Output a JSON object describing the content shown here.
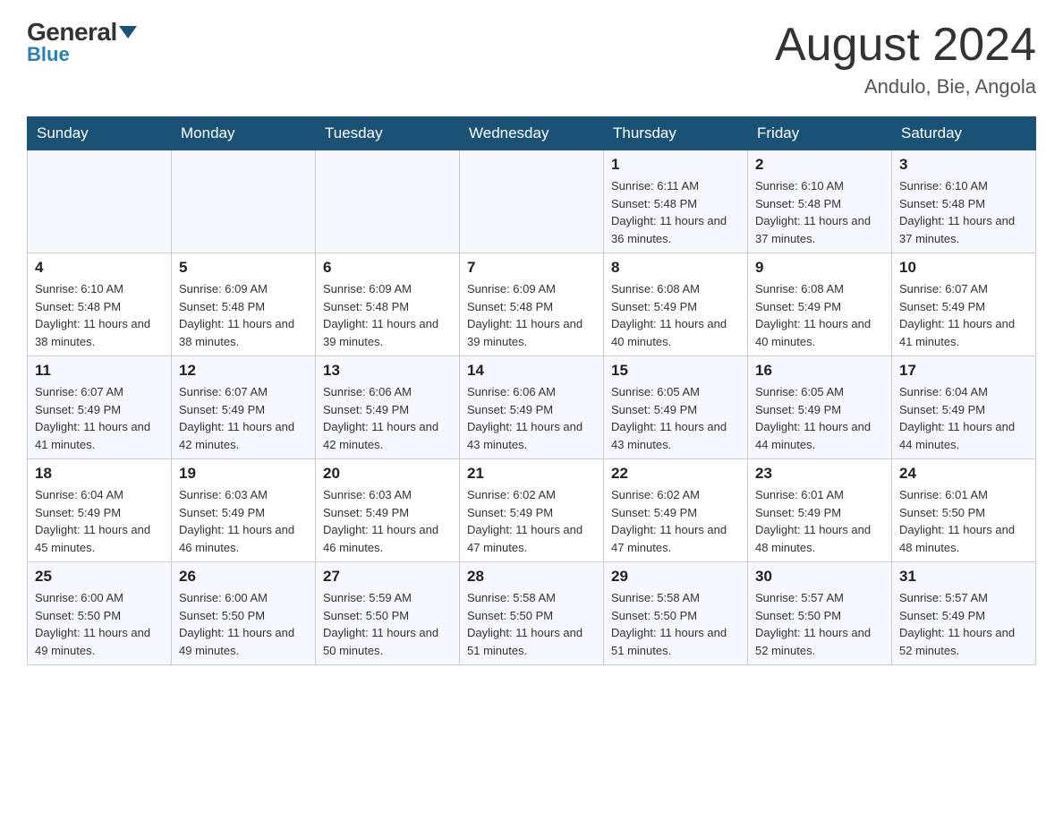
{
  "header": {
    "logo_general": "General",
    "logo_blue": "Blue",
    "month_year": "August 2024",
    "location": "Andulo, Bie, Angola"
  },
  "days_of_week": [
    "Sunday",
    "Monday",
    "Tuesday",
    "Wednesday",
    "Thursday",
    "Friday",
    "Saturday"
  ],
  "weeks": [
    [
      {
        "day": "",
        "info": ""
      },
      {
        "day": "",
        "info": ""
      },
      {
        "day": "",
        "info": ""
      },
      {
        "day": "",
        "info": ""
      },
      {
        "day": "1",
        "info": "Sunrise: 6:11 AM\nSunset: 5:48 PM\nDaylight: 11 hours and 36 minutes."
      },
      {
        "day": "2",
        "info": "Sunrise: 6:10 AM\nSunset: 5:48 PM\nDaylight: 11 hours and 37 minutes."
      },
      {
        "day": "3",
        "info": "Sunrise: 6:10 AM\nSunset: 5:48 PM\nDaylight: 11 hours and 37 minutes."
      }
    ],
    [
      {
        "day": "4",
        "info": "Sunrise: 6:10 AM\nSunset: 5:48 PM\nDaylight: 11 hours and 38 minutes."
      },
      {
        "day": "5",
        "info": "Sunrise: 6:09 AM\nSunset: 5:48 PM\nDaylight: 11 hours and 38 minutes."
      },
      {
        "day": "6",
        "info": "Sunrise: 6:09 AM\nSunset: 5:48 PM\nDaylight: 11 hours and 39 minutes."
      },
      {
        "day": "7",
        "info": "Sunrise: 6:09 AM\nSunset: 5:48 PM\nDaylight: 11 hours and 39 minutes."
      },
      {
        "day": "8",
        "info": "Sunrise: 6:08 AM\nSunset: 5:49 PM\nDaylight: 11 hours and 40 minutes."
      },
      {
        "day": "9",
        "info": "Sunrise: 6:08 AM\nSunset: 5:49 PM\nDaylight: 11 hours and 40 minutes."
      },
      {
        "day": "10",
        "info": "Sunrise: 6:07 AM\nSunset: 5:49 PM\nDaylight: 11 hours and 41 minutes."
      }
    ],
    [
      {
        "day": "11",
        "info": "Sunrise: 6:07 AM\nSunset: 5:49 PM\nDaylight: 11 hours and 41 minutes."
      },
      {
        "day": "12",
        "info": "Sunrise: 6:07 AM\nSunset: 5:49 PM\nDaylight: 11 hours and 42 minutes."
      },
      {
        "day": "13",
        "info": "Sunrise: 6:06 AM\nSunset: 5:49 PM\nDaylight: 11 hours and 42 minutes."
      },
      {
        "day": "14",
        "info": "Sunrise: 6:06 AM\nSunset: 5:49 PM\nDaylight: 11 hours and 43 minutes."
      },
      {
        "day": "15",
        "info": "Sunrise: 6:05 AM\nSunset: 5:49 PM\nDaylight: 11 hours and 43 minutes."
      },
      {
        "day": "16",
        "info": "Sunrise: 6:05 AM\nSunset: 5:49 PM\nDaylight: 11 hours and 44 minutes."
      },
      {
        "day": "17",
        "info": "Sunrise: 6:04 AM\nSunset: 5:49 PM\nDaylight: 11 hours and 44 minutes."
      }
    ],
    [
      {
        "day": "18",
        "info": "Sunrise: 6:04 AM\nSunset: 5:49 PM\nDaylight: 11 hours and 45 minutes."
      },
      {
        "day": "19",
        "info": "Sunrise: 6:03 AM\nSunset: 5:49 PM\nDaylight: 11 hours and 46 minutes."
      },
      {
        "day": "20",
        "info": "Sunrise: 6:03 AM\nSunset: 5:49 PM\nDaylight: 11 hours and 46 minutes."
      },
      {
        "day": "21",
        "info": "Sunrise: 6:02 AM\nSunset: 5:49 PM\nDaylight: 11 hours and 47 minutes."
      },
      {
        "day": "22",
        "info": "Sunrise: 6:02 AM\nSunset: 5:49 PM\nDaylight: 11 hours and 47 minutes."
      },
      {
        "day": "23",
        "info": "Sunrise: 6:01 AM\nSunset: 5:49 PM\nDaylight: 11 hours and 48 minutes."
      },
      {
        "day": "24",
        "info": "Sunrise: 6:01 AM\nSunset: 5:50 PM\nDaylight: 11 hours and 48 minutes."
      }
    ],
    [
      {
        "day": "25",
        "info": "Sunrise: 6:00 AM\nSunset: 5:50 PM\nDaylight: 11 hours and 49 minutes."
      },
      {
        "day": "26",
        "info": "Sunrise: 6:00 AM\nSunset: 5:50 PM\nDaylight: 11 hours and 49 minutes."
      },
      {
        "day": "27",
        "info": "Sunrise: 5:59 AM\nSunset: 5:50 PM\nDaylight: 11 hours and 50 minutes."
      },
      {
        "day": "28",
        "info": "Sunrise: 5:58 AM\nSunset: 5:50 PM\nDaylight: 11 hours and 51 minutes."
      },
      {
        "day": "29",
        "info": "Sunrise: 5:58 AM\nSunset: 5:50 PM\nDaylight: 11 hours and 51 minutes."
      },
      {
        "day": "30",
        "info": "Sunrise: 5:57 AM\nSunset: 5:50 PM\nDaylight: 11 hours and 52 minutes."
      },
      {
        "day": "31",
        "info": "Sunrise: 5:57 AM\nSunset: 5:49 PM\nDaylight: 11 hours and 52 minutes."
      }
    ]
  ]
}
